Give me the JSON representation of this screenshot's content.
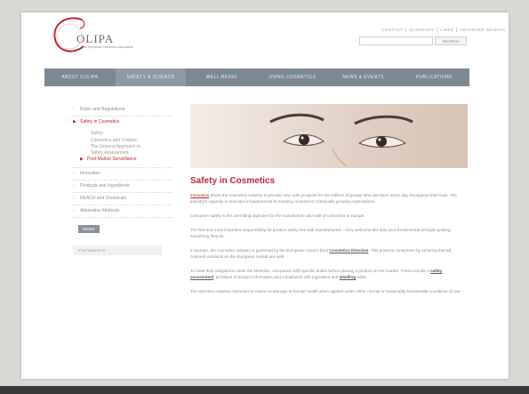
{
  "header": {
    "logo_word": "OLIPA",
    "logo_tagline": "The European Cosmetics Association",
    "top_links": [
      "CONTACT",
      "GLOSSARY",
      "LINKS",
      "ADVANCED SEARCH"
    ],
    "search_button": "SEARCH",
    "search_value": ""
  },
  "nav": {
    "items": [
      "ABOUT COLIPA",
      "SAFETY & SCIENCE",
      "WELL-BEING",
      "USING COSMETICS",
      "NEWS & EVENTS",
      "PUBLICATIONS"
    ],
    "active_index": 1
  },
  "sidebar": {
    "items_before": [
      "Rules and Regulations"
    ],
    "active_item": "Safety in Cosmetics",
    "sub_items": [
      "Safety",
      "Cosmetics and Children",
      "The General Approach to",
      "Safety Assessment"
    ],
    "highlighted_sub": "Post-Market Surveillance",
    "items_after": [
      "Innovation",
      "Products and Ingredients",
      "REACH and Chemicals",
      "Alternative Methods"
    ],
    "news_badge": "NEWS",
    "stat_box": "STATEMENTS"
  },
  "content": {
    "title": "Safety in Cosmetics",
    "p1_link": "Innovation",
    "p1_text": " drives the cosmetics industry to provide new, safe products for the millions of people who use them every day, throughout their lives. The industry's capacity to innovate is fundamental to meeting consumers' continually growing expectations.",
    "p2": "Consumer safety is the overriding objective for the manufacture and sale of cosmetics in Europe.",
    "p3": "The first and most important responsibility for product safety lies with manufacturers – they welcome this duty as a fundamental principle guiding everything they do.",
    "p4_a": "In Europe, the cosmetics industry is governed by the European Union's (EU) ",
    "p4_link": "Cosmetics Directive",
    "p4_b": ". This protects consumers by ensuring that all cosmetic products on the European market are safe.",
    "p5_a": "To meet their obligations under the Directive, companies fulfil specific duties before placing a product on the market. These include a ",
    "p5_link1": "safety assessment",
    "p5_b": ", provision of product information and compliance with ingredient and ",
    "p5_link2": "labelling",
    "p5_c": " rules.",
    "p6": "The Directive requires cosmetics to cause no damage to human health when applied under either normal or reasonably foreseeable conditions of use."
  },
  "colors": {
    "accent": "#c0282c",
    "nav_bg": "#7b8993",
    "background": "#d9d8d4"
  }
}
